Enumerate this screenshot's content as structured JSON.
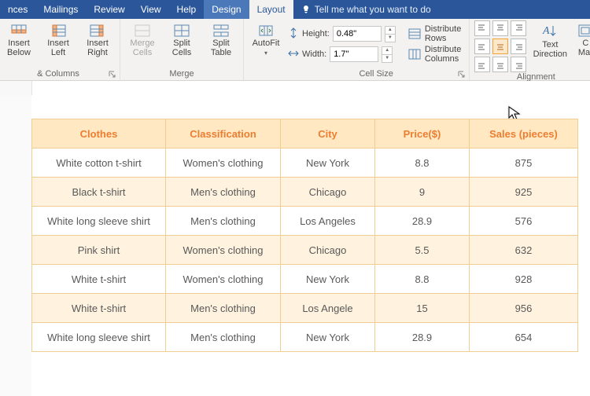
{
  "tabs": {
    "nces": "nces",
    "mailings": "Mailings",
    "review": "Review",
    "view": "View",
    "help": "Help",
    "design": "Design",
    "layout": "Layout",
    "tell": "Tell me what you want to do"
  },
  "ribbon": {
    "insert_below": "Insert\nBelow",
    "insert_left": "Insert\nLeft",
    "insert_right": "Insert\nRight",
    "group_rc": "& Columns",
    "merge_cells": "Merge\nCells",
    "split_cells": "Split\nCells",
    "split_table": "Split\nTable",
    "group_merge": "Merge",
    "autofit": "AutoFit",
    "height_label": "Height:",
    "height_value": "0.48\"",
    "width_label": "Width:",
    "width_value": "1.7\"",
    "dist_rows": "Distribute Rows",
    "dist_cols": "Distribute Columns",
    "group_cellsize": "Cell Size",
    "text_direction": "Text\nDirection",
    "cell_margins": "C\nMar",
    "group_alignment": "Alignment"
  },
  "table": {
    "headers": {
      "c1": "Clothes",
      "c2": "Classification",
      "c3": "City",
      "c4": "Price($)",
      "c5": "Sales (pieces)"
    },
    "rows": [
      {
        "c1": "White cotton t-shirt",
        "c2": "Women's clothing",
        "c3": "New York",
        "c4": "8.8",
        "c5": "875"
      },
      {
        "c1": "Black t-shirt",
        "c2": "Men's clothing",
        "c3": "Chicago",
        "c4": "9",
        "c5": "925"
      },
      {
        "c1": "White long sleeve shirt",
        "c2": "Men's clothing",
        "c3": "Los Angeles",
        "c4": "28.9",
        "c5": "576"
      },
      {
        "c1": "Pink shirt",
        "c2": "Women's clothing",
        "c3": "Chicago",
        "c4": "5.5",
        "c5": "632"
      },
      {
        "c1": "White t-shirt",
        "c2": "Women's clothing",
        "c3": "New York",
        "c4": "8.8",
        "c5": "928"
      },
      {
        "c1": "White t-shirt",
        "c2": "Men's clothing",
        "c3": "Los Angele",
        "c4": "15",
        "c5": "956"
      },
      {
        "c1": "White long sleeve shirt",
        "c2": "Men's clothing",
        "c3": "New York",
        "c4": "28.9",
        "c5": "654"
      }
    ]
  }
}
